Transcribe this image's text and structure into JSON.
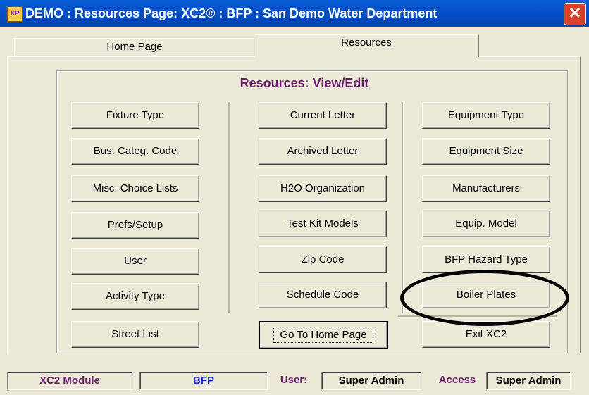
{
  "window": {
    "title": "DEMO : Resources Page:  XC2® : BFP : San Demo Water Department",
    "app_icon_text": "XP",
    "close_glyph": "✕"
  },
  "tabs": [
    {
      "label": "Home Page"
    },
    {
      "label": "Resources",
      "active": true
    }
  ],
  "heading": "Resources:  View/Edit",
  "column1": [
    "Fixture Type",
    "Bus. Categ. Code",
    "Misc. Choice Lists",
    "Prefs/Setup",
    "User",
    "Activity Type",
    "Street List"
  ],
  "column2": [
    "Current Letter",
    "Archived Letter",
    "H2O Organization",
    "Test Kit Models",
    "Zip Code",
    "Schedule Code",
    "Go To Home Page"
  ],
  "column3": [
    "Equipment Type",
    "Equipment Size",
    "Manufacturers",
    "Equip. Model",
    "BFP Hazard Type",
    "Boiler Plates",
    "Exit XC2"
  ],
  "status": {
    "module_label": "XC2 Module",
    "module_value": "BFP",
    "user_label": "User:",
    "user_value": "Super Admin",
    "access_label": "Access",
    "access_value": "Super Admin"
  },
  "colors": {
    "title_bar": "#0550c8",
    "heading": "#6b1c6b",
    "status_value": "#1a2dcc"
  }
}
